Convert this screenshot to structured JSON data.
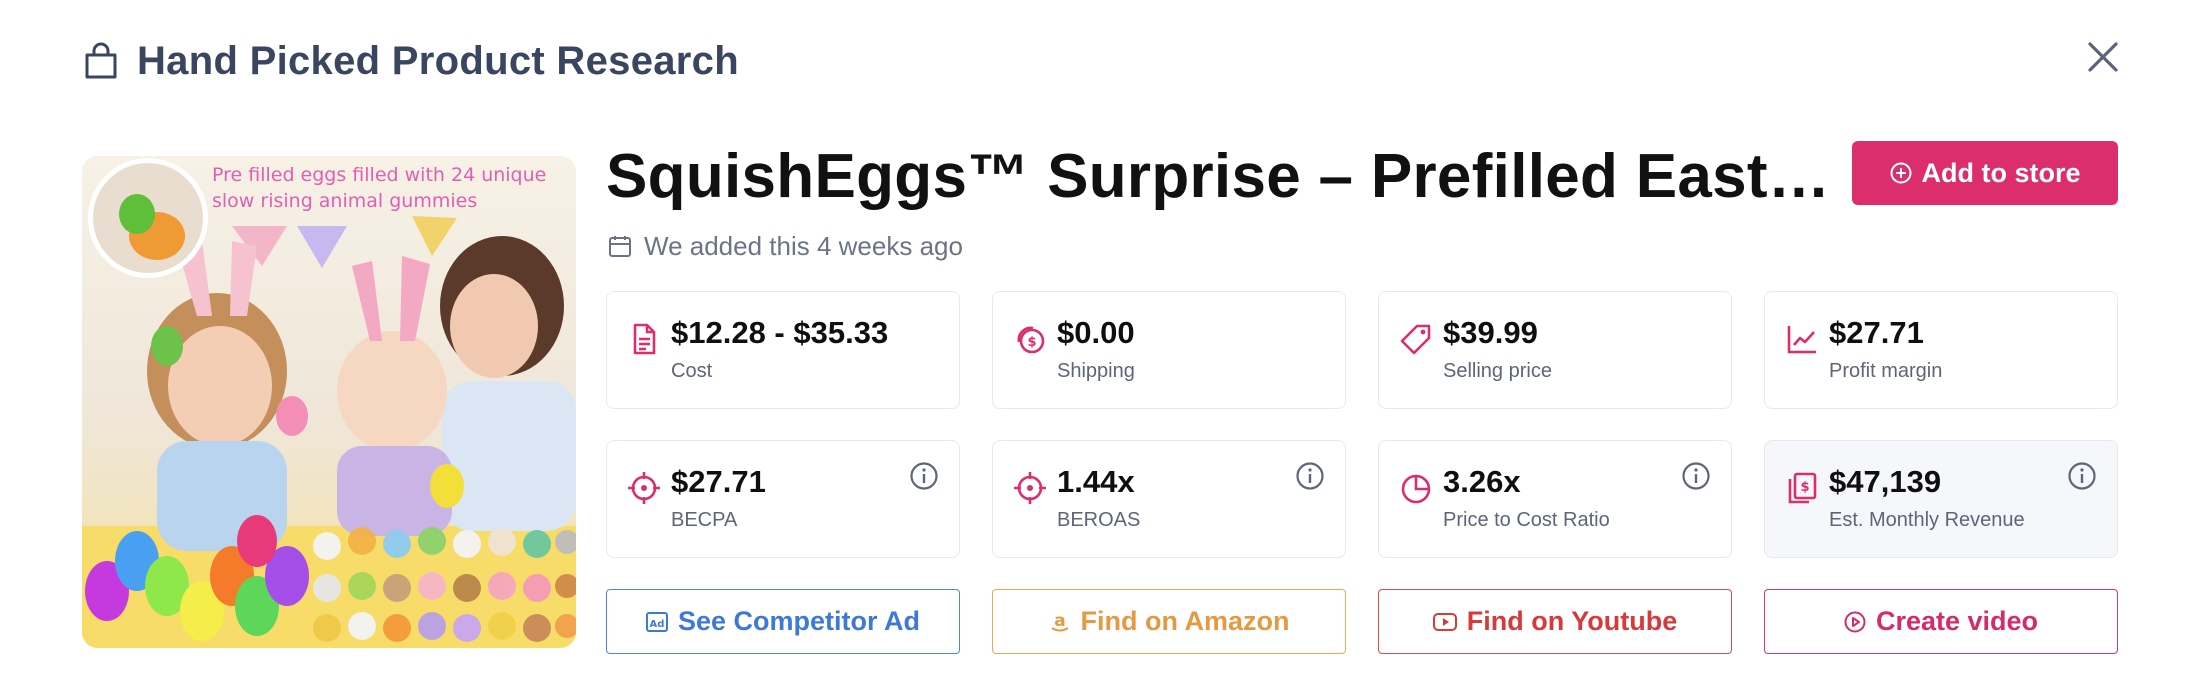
{
  "header": {
    "title": "Hand Picked Product Research"
  },
  "product": {
    "image_caption": "Pre filled eggs filled with 24 unique slow rising animal gummies",
    "title": "SquishEggs™ Surprise – Prefilled East…",
    "added": "We added this 4 weeks ago",
    "add_button": "Add to store"
  },
  "metrics": [
    {
      "value": "$12.28 - $35.33",
      "label": "Cost",
      "icon": "document-icon"
    },
    {
      "value": "$0.00",
      "label": "Shipping",
      "icon": "coins-icon"
    },
    {
      "value": "$39.99",
      "label": "Selling price",
      "icon": "tag-icon"
    },
    {
      "value": "$27.71",
      "label": "Profit margin",
      "icon": "trend-chart-icon"
    },
    {
      "value": "$27.71",
      "label": "BECPA",
      "icon": "crosshair-icon"
    },
    {
      "value": "1.44x",
      "label": "BEROAS",
      "icon": "crosshair-icon"
    },
    {
      "value": "3.26x",
      "label": "Price to Cost Ratio",
      "icon": "pie-chart-icon"
    },
    {
      "value": "$47,139",
      "label": "Est. Monthly Revenue",
      "icon": "money-stack-icon"
    }
  ],
  "actions": [
    {
      "label": "See Competitor Ad",
      "icon": "ad-icon"
    },
    {
      "label": "Find on Amazon",
      "icon": "amazon-icon"
    },
    {
      "label": "Find on Youtube",
      "icon": "youtube-icon"
    },
    {
      "label": "Create video",
      "icon": "play-circle-icon"
    }
  ],
  "colors": {
    "accent": "#dc2e6c",
    "competitor": "#3f79d6",
    "amazon": "#e49a40",
    "youtube": "#d63b3b",
    "create": "#d62b69",
    "title_text": "#3a4660"
  }
}
